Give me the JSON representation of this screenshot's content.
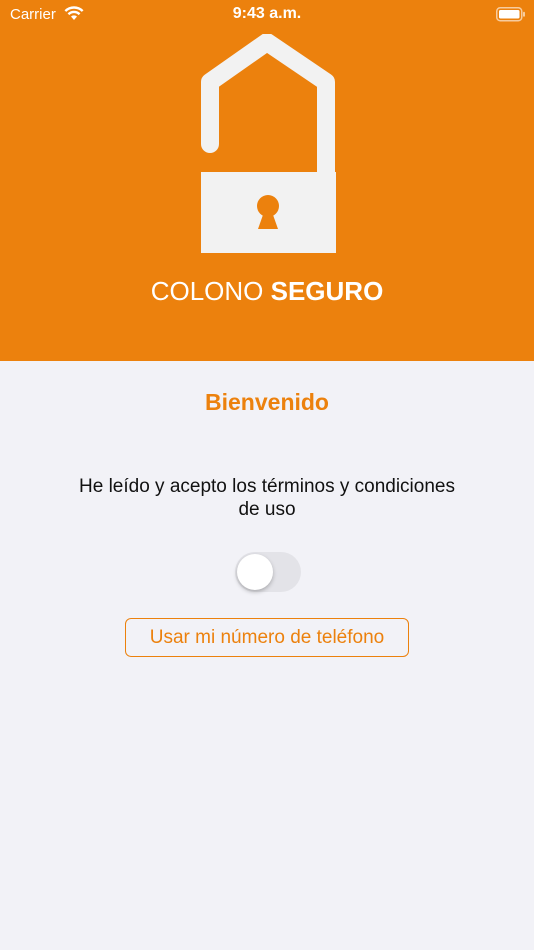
{
  "status_bar": {
    "carrier": "Carrier",
    "time": "9:43 a.m."
  },
  "brand": {
    "name_light": "COLONO",
    "name_bold": "SEGURO",
    "logo_icon": "open-padlock-icon"
  },
  "main": {
    "welcome": "Bienvenido",
    "terms_text": "He leído y acepto los términos y condiciones de uso",
    "terms_accepted": false,
    "phone_button_label": "Usar mi número de teléfono"
  },
  "colors": {
    "accent": "#ec810d",
    "background": "#f2f2f7"
  }
}
